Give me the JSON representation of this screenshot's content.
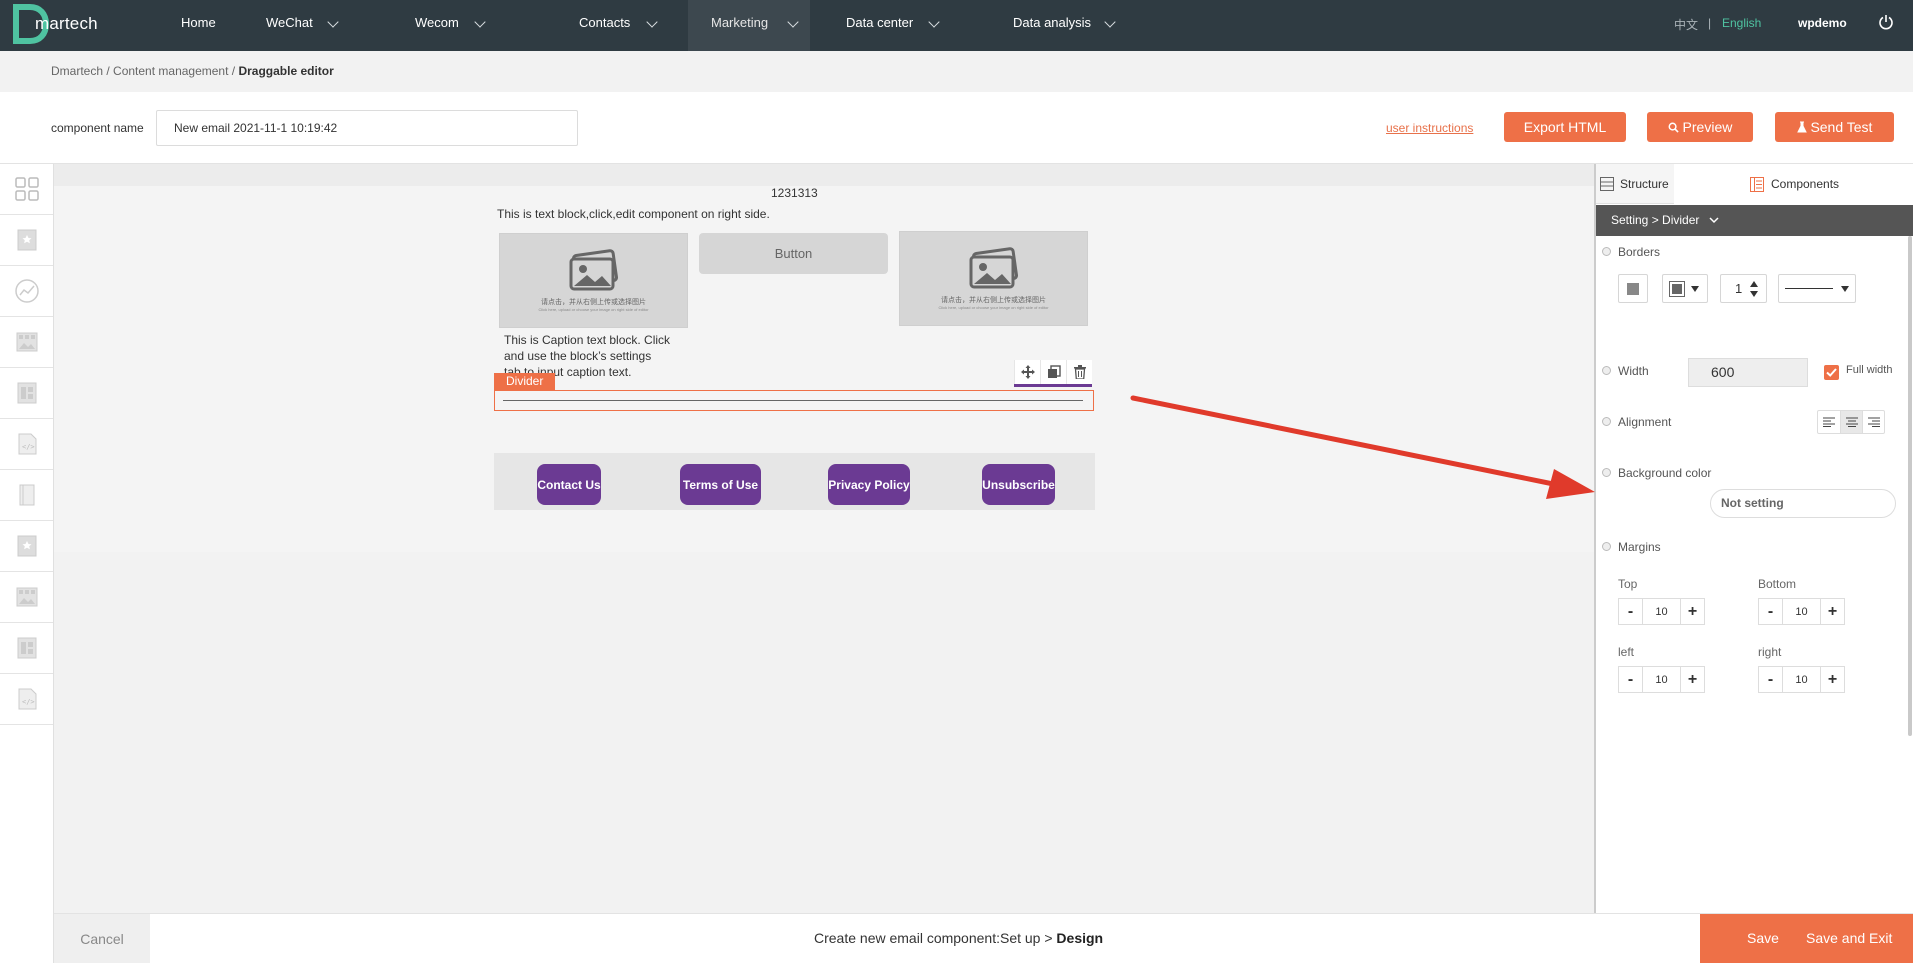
{
  "nav": {
    "logo_text": "martech",
    "items": [
      {
        "label": "Home",
        "has_dropdown": false
      },
      {
        "label": "WeChat",
        "has_dropdown": true
      },
      {
        "label": "Wecom",
        "has_dropdown": true
      },
      {
        "label": "Contacts",
        "has_dropdown": true
      },
      {
        "label": "Marketing",
        "has_dropdown": true,
        "active": true
      },
      {
        "label": "Data center",
        "has_dropdown": true
      },
      {
        "label": "Data analysis",
        "has_dropdown": true
      }
    ],
    "lang_zh": "中文",
    "lang_sep": "|",
    "lang_en": "English",
    "user": "wpdemo"
  },
  "breadcrumb": {
    "level1": "Dmartech",
    "sep": " / ",
    "level2": "Content management",
    "current": "Draggable editor"
  },
  "titlebar": {
    "component_name_label": "component name",
    "component_name_value": "New email 2021-11-1 10:19:42",
    "user_instructions": "user instructions",
    "export_html": "Export HTML",
    "preview": "Preview",
    "send_test": "Send Test"
  },
  "canvas": {
    "heading": "1231313",
    "text_block": "This is text block,click,edit component on right side.",
    "image_caption_zh": "请点击，并从右侧上传或选择图片",
    "image_caption_en": "Click here, upload or choose your image on right side of editor",
    "button_label": "Button",
    "caption_line1": "This is Caption text block. Click",
    "caption_line2": "and use the block’s settings",
    "caption_line3": "tab to input caption text.",
    "divider_tag": "Divider",
    "footer_buttons": [
      "Contact Us",
      "Terms of Use",
      "Privacy Policy",
      "Unsubscribe"
    ]
  },
  "panel": {
    "tab_structure": "Structure",
    "tab_components": "Components",
    "setting_path": "Setting > Divider",
    "borders_label": "Borders",
    "border_width": "1",
    "width_label": "Width",
    "width_value": "600",
    "full_width_label": "Full width",
    "full_width_checked": true,
    "alignment_label": "Alignment",
    "bg_color_label": "Background color",
    "bg_color_value": "Not setting",
    "margins_label": "Margins",
    "margins": {
      "top_label": "Top",
      "top": "10",
      "bottom_label": "Bottom",
      "bottom": "10",
      "left_label": "left",
      "left": "10",
      "right_label": "right",
      "right": "10"
    },
    "minus": "-",
    "plus": "+"
  },
  "bottom": {
    "cancel": "Cancel",
    "step_prefix": "Create new email component:Set up > ",
    "step_current": "Design",
    "save": "Save",
    "save_exit": "Save and Exit"
  },
  "colors": {
    "accent": "#ee7047",
    "nav_bg": "#2f3b42",
    "purple": "#6b3a93",
    "lang_active": "#4fc3a1"
  }
}
